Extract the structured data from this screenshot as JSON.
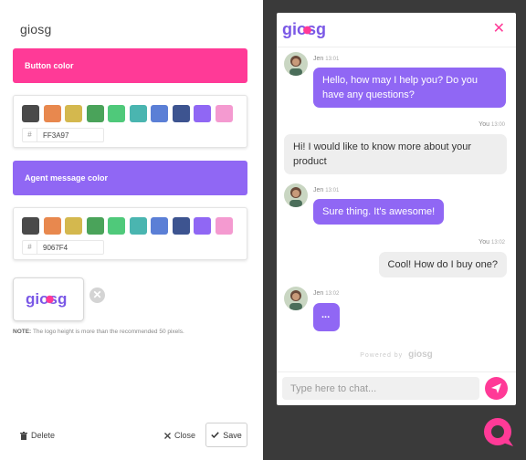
{
  "settings": {
    "title": "giosg",
    "button_color": {
      "label": "Button color",
      "hex": "FF3A97",
      "color": "#ff3a97"
    },
    "agent_color": {
      "label": "Agent message color",
      "hex": "9067F4",
      "color": "#9067f4"
    },
    "swatches": [
      "#4a4a4a",
      "#e8884e",
      "#d4b84e",
      "#4aa35a",
      "#4fc97a",
      "#4ab5b0",
      "#5b7fd6",
      "#3d5490",
      "#9067f4",
      "#f49ad0"
    ],
    "hash_symbol": "#",
    "logo_text": "giosg",
    "note_label": "NOTE:",
    "note_text": "The logo height is more than the recommended 50 pixels.",
    "delete_label": "Delete",
    "close_label": "Close",
    "save_label": "Save",
    "remove_icon_glyph": "✕"
  },
  "chat": {
    "logo_text": "giosg",
    "close_glyph": "✕",
    "messages": [
      {
        "sender": "Jen",
        "time": "13:01",
        "text": "Hello, how may I help you? Do you have any questions?"
      },
      {
        "sender": "You",
        "time": "13:00",
        "text": "Hi! I would like to know more about your product"
      },
      {
        "sender": "Jen",
        "time": "13:01",
        "text": "Sure thing. It's awesome!"
      },
      {
        "sender": "You",
        "time": "13:02",
        "text": "Cool! How do I buy one?"
      },
      {
        "sender": "Jen",
        "time": "13:02",
        "text": "..."
      }
    ],
    "powered_by": "Powered by",
    "powered_brand": "giosg",
    "input_placeholder": "Type here to chat..."
  }
}
